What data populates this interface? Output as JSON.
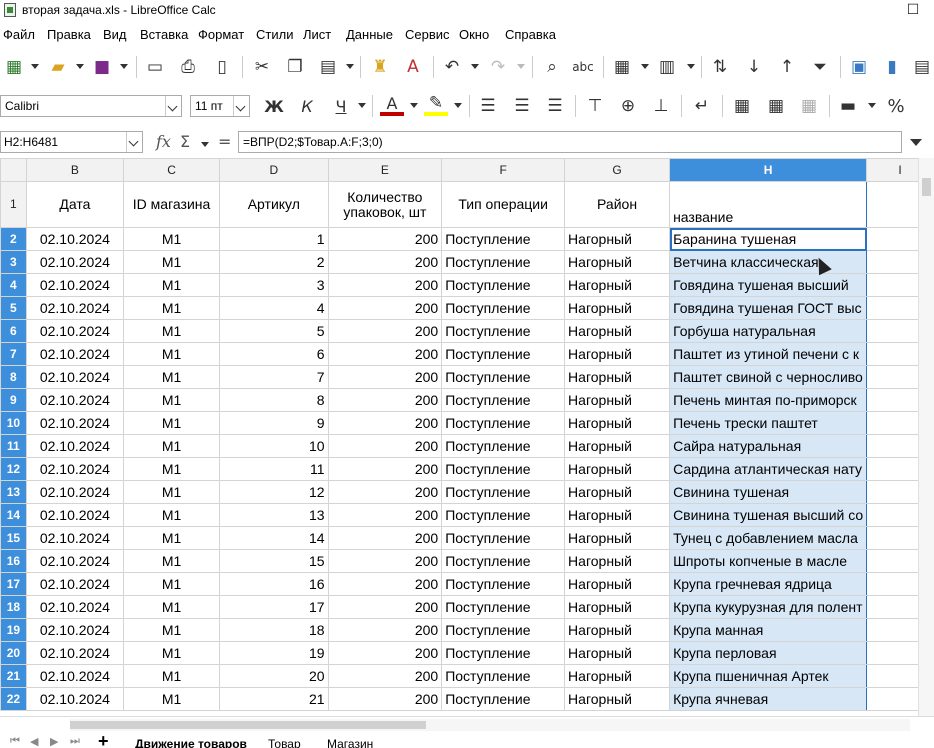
{
  "window": {
    "title": "вторая задача.xls - LibreOffice Calc",
    "maximize_glyph": "☐"
  },
  "menu": [
    "Файл",
    "Правка",
    "Вид",
    "Вставка",
    "Формат",
    "Стили",
    "Лист",
    "Данные",
    "Сервис",
    "Окно",
    "Справка"
  ],
  "format_bar": {
    "font_name": "Calibri",
    "font_size": "11 пт",
    "bold": "Ж",
    "italic": "К",
    "underline": "Ч",
    "font_color_glyph": "А",
    "percent": "%"
  },
  "formula_bar": {
    "name_box": "H2:H6481",
    "sigma": "Σ",
    "equals": "=",
    "formula": "=ВПР(D2;$Товар.A:F;3;0)"
  },
  "columns": [
    "B",
    "C",
    "D",
    "E",
    "F",
    "G",
    "H",
    "I"
  ],
  "header_row": {
    "row_num": "1",
    "cells": [
      "Дата",
      "ID магазина",
      "Артикул",
      "Количество упаковок, шт",
      "Тип операции",
      "Район",
      "название",
      ""
    ]
  },
  "rows": [
    {
      "n": "2",
      "date": "02.10.2024",
      "shop": "M1",
      "sku": "1",
      "qty": "200",
      "op": "Поступление",
      "area": "Нагорный",
      "name": "Баранина тушеная"
    },
    {
      "n": "3",
      "date": "02.10.2024",
      "shop": "M1",
      "sku": "2",
      "qty": "200",
      "op": "Поступление",
      "area": "Нагорный",
      "name": "Ветчина классическая"
    },
    {
      "n": "4",
      "date": "02.10.2024",
      "shop": "M1",
      "sku": "3",
      "qty": "200",
      "op": "Поступление",
      "area": "Нагорный",
      "name": "Говядина тушеная  высший"
    },
    {
      "n": "5",
      "date": "02.10.2024",
      "shop": "M1",
      "sku": "4",
      "qty": "200",
      "op": "Поступление",
      "area": "Нагорный",
      "name": "Говядина тушеная ГОСТ выс"
    },
    {
      "n": "6",
      "date": "02.10.2024",
      "shop": "M1",
      "sku": "5",
      "qty": "200",
      "op": "Поступление",
      "area": "Нагорный",
      "name": "Горбуша натуральная"
    },
    {
      "n": "7",
      "date": "02.10.2024",
      "shop": "M1",
      "sku": "6",
      "qty": "200",
      "op": "Поступление",
      "area": "Нагорный",
      "name": "Паштет из утиной печени с к"
    },
    {
      "n": "8",
      "date": "02.10.2024",
      "shop": "M1",
      "sku": "7",
      "qty": "200",
      "op": "Поступление",
      "area": "Нагорный",
      "name": "Паштет свиной с черносливо"
    },
    {
      "n": "9",
      "date": "02.10.2024",
      "shop": "M1",
      "sku": "8",
      "qty": "200",
      "op": "Поступление",
      "area": "Нагорный",
      "name": "Печень минтая по-приморск"
    },
    {
      "n": "10",
      "date": "02.10.2024",
      "shop": "M1",
      "sku": "9",
      "qty": "200",
      "op": "Поступление",
      "area": "Нагорный",
      "name": "Печень трески паштет"
    },
    {
      "n": "11",
      "date": "02.10.2024",
      "shop": "M1",
      "sku": "10",
      "qty": "200",
      "op": "Поступление",
      "area": "Нагорный",
      "name": "Сайра натуральная"
    },
    {
      "n": "12",
      "date": "02.10.2024",
      "shop": "M1",
      "sku": "11",
      "qty": "200",
      "op": "Поступление",
      "area": "Нагорный",
      "name": "Сардина атлантическая нату"
    },
    {
      "n": "13",
      "date": "02.10.2024",
      "shop": "M1",
      "sku": "12",
      "qty": "200",
      "op": "Поступление",
      "area": "Нагорный",
      "name": "Свинина тушеная"
    },
    {
      "n": "14",
      "date": "02.10.2024",
      "shop": "M1",
      "sku": "13",
      "qty": "200",
      "op": "Поступление",
      "area": "Нагорный",
      "name": "Свинина тушеная высший со"
    },
    {
      "n": "15",
      "date": "02.10.2024",
      "shop": "M1",
      "sku": "14",
      "qty": "200",
      "op": "Поступление",
      "area": "Нагорный",
      "name": "Тунец с добавлением масла"
    },
    {
      "n": "16",
      "date": "02.10.2024",
      "shop": "M1",
      "sku": "15",
      "qty": "200",
      "op": "Поступление",
      "area": "Нагорный",
      "name": "Шпроты копченые в масле"
    },
    {
      "n": "17",
      "date": "02.10.2024",
      "shop": "M1",
      "sku": "16",
      "qty": "200",
      "op": "Поступление",
      "area": "Нагорный",
      "name": "Крупа гречневая ядрица"
    },
    {
      "n": "18",
      "date": "02.10.2024",
      "shop": "M1",
      "sku": "17",
      "qty": "200",
      "op": "Поступление",
      "area": "Нагорный",
      "name": "Крупа кукурузная для полент"
    },
    {
      "n": "19",
      "date": "02.10.2024",
      "shop": "M1",
      "sku": "18",
      "qty": "200",
      "op": "Поступление",
      "area": "Нагорный",
      "name": "Крупа манная"
    },
    {
      "n": "20",
      "date": "02.10.2024",
      "shop": "M1",
      "sku": "19",
      "qty": "200",
      "op": "Поступление",
      "area": "Нагорный",
      "name": "Крупа перловая"
    },
    {
      "n": "21",
      "date": "02.10.2024",
      "shop": "M1",
      "sku": "20",
      "qty": "200",
      "op": "Поступление",
      "area": "Нагорный",
      "name": "Крупа пшеничная Артек"
    },
    {
      "n": "22",
      "date": "02.10.2024",
      "shop": "M1",
      "sku": "21",
      "qty": "200",
      "op": "Поступление",
      "area": "Нагорный",
      "name": "Крупа ячневая"
    }
  ],
  "sheet_tabs": {
    "add": "+",
    "tabs": [
      "Движение товаров",
      "Товар",
      "Магазин"
    ],
    "active": 0
  }
}
